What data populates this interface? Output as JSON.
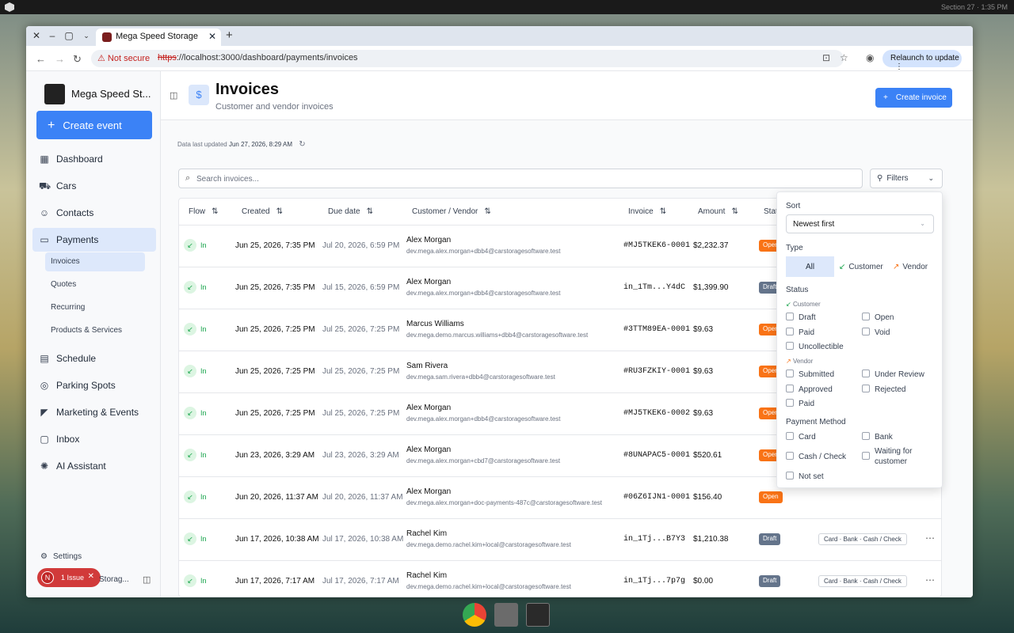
{
  "os": {
    "clock": "Section 27 · 1:35 PM"
  },
  "browser": {
    "tab_title": "Mega Speed Storage",
    "not_secure": "Not secure",
    "url_protocol": "https",
    "url_rest": "://localhost:3000/dashboard/payments/invoices",
    "relaunch": "Relaunch to update"
  },
  "sidebar": {
    "brand": "Mega Speed St...",
    "logo_text": "MEGA SPEED STORAGE",
    "create_event": "Create event",
    "items": [
      {
        "label": "Dashboard",
        "icon": "grid-icon"
      },
      {
        "label": "Cars",
        "icon": "car-icon"
      },
      {
        "label": "Contacts",
        "icon": "users-icon"
      },
      {
        "label": "Payments",
        "icon": "card-icon"
      },
      {
        "label": "Schedule",
        "icon": "calendar-icon"
      },
      {
        "label": "Parking Spots",
        "icon": "pin-icon"
      },
      {
        "label": "Marketing & Events",
        "icon": "megaphone-icon"
      },
      {
        "label": "Inbox",
        "icon": "chat-icon"
      },
      {
        "label": "AI Assistant",
        "icon": "brain-icon"
      }
    ],
    "sub_items": [
      "Invoices",
      "Quotes",
      "Recurring",
      "Products & Services"
    ],
    "settings": "Settings",
    "issue_avatar": "N",
    "issue_label": "1 Issue",
    "footer_name": "Storag..."
  },
  "header": {
    "title": "Invoices",
    "subtitle": "Customer and vendor invoices",
    "create_invoice": "Create invoice"
  },
  "updated": {
    "label": "Data last updated",
    "value": "Jun 27, 2026, 8:29 AM"
  },
  "search": {
    "placeholder": "Search invoices..."
  },
  "filters_button": "Filters",
  "table": {
    "columns": [
      "Flow",
      "Created",
      "Due date",
      "Customer / Vendor",
      "Invoice",
      "Amount",
      "Stat"
    ],
    "rows": [
      {
        "flow": "In",
        "created": "Jun 25, 2026, 7:35 PM",
        "due": "Jul 20, 2026, 6:59 PM",
        "name": "Alex Morgan",
        "email": "dev.mega.alex.morgan+dbb4@carstoragesoftware.test",
        "invoice": "#MJ5TKEK6-0001",
        "amount": "$2,232.37",
        "status": "Open",
        "pm": ""
      },
      {
        "flow": "In",
        "created": "Jun 25, 2026, 7:35 PM",
        "due": "Jul 15, 2026, 6:59 PM",
        "name": "Alex Morgan",
        "email": "dev.mega.alex.morgan+dbb4@carstoragesoftware.test",
        "invoice": "in_1Tm...Y4dC",
        "amount": "$1,399.90",
        "status": "Draft",
        "pm": ""
      },
      {
        "flow": "In",
        "created": "Jun 25, 2026, 7:25 PM",
        "due": "Jul 25, 2026, 7:25 PM",
        "name": "Marcus Williams",
        "email": "dev.mega.demo.marcus.williams+dbb4@carstoragesoftware.test",
        "invoice": "#3TTM89EA-0001",
        "amount": "$9.63",
        "status": "Open",
        "pm": ""
      },
      {
        "flow": "In",
        "created": "Jun 25, 2026, 7:25 PM",
        "due": "Jul 25, 2026, 7:25 PM",
        "name": "Sam Rivera",
        "email": "dev.mega.sam.rivera+dbb4@carstoragesoftware.test",
        "invoice": "#RU3FZKIY-0001",
        "amount": "$9.63",
        "status": "Open",
        "pm": ""
      },
      {
        "flow": "In",
        "created": "Jun 25, 2026, 7:25 PM",
        "due": "Jul 25, 2026, 7:25 PM",
        "name": "Alex Morgan",
        "email": "dev.mega.alex.morgan+dbb4@carstoragesoftware.test",
        "invoice": "#MJ5TKEK6-0002",
        "amount": "$9.63",
        "status": "Open",
        "pm": ""
      },
      {
        "flow": "In",
        "created": "Jun 23, 2026, 3:29 AM",
        "due": "Jul 23, 2026, 3:29 AM",
        "name": "Alex Morgan",
        "email": "dev.mega.alex.morgan+cbd7@carstoragesoftware.test",
        "invoice": "#8UNAPAC5-0001",
        "amount": "$520.61",
        "status": "Open",
        "pm": ""
      },
      {
        "flow": "In",
        "created": "Jun 20, 2026, 11:37 AM",
        "due": "Jul 20, 2026, 11:37 AM",
        "name": "Alex Morgan",
        "email": "dev.mega.alex.morgan+doc-payments-487c@carstoragesoftware.test",
        "invoice": "#06Z6IJN1-0001",
        "amount": "$156.40",
        "status": "Open",
        "pm": ""
      },
      {
        "flow": "In",
        "created": "Jun 17, 2026, 10:38 AM",
        "due": "Jul 17, 2026, 10:38 AM",
        "name": "Rachel Kim",
        "email": "dev.mega.demo.rachel.kim+local@carstoragesoftware.test",
        "invoice": "in_1Tj...B7Y3",
        "amount": "$1,210.38",
        "status": "Draft",
        "pm": "Card · Bank · Cash / Check"
      },
      {
        "flow": "In",
        "created": "Jun 17, 2026, 7:17 AM",
        "due": "Jul 17, 2026, 7:17 AM",
        "name": "Rachel Kim",
        "email": "dev.mega.demo.rachel.kim+local@carstoragesoftware.test",
        "invoice": "in_1Tj...7p7g",
        "amount": "$0.00",
        "status": "Draft",
        "pm": "Card · Bank · Cash / Check"
      }
    ]
  },
  "filter_panel": {
    "sort_label": "Sort",
    "sort_value": "Newest first",
    "type_label": "Type",
    "type_options": [
      "All",
      "Customer",
      "Vendor"
    ],
    "status_label": "Status",
    "customer_group": "Customer",
    "customer_statuses": [
      "Draft",
      "Open",
      "Paid",
      "Void",
      "Uncollectible"
    ],
    "vendor_group": "Vendor",
    "vendor_statuses": [
      "Submitted",
      "Under Review",
      "Approved",
      "Rejected",
      "Paid"
    ],
    "payment_label": "Payment Method",
    "payment_methods": [
      "Card",
      "Bank",
      "Cash / Check",
      "Waiting for customer",
      "Not set"
    ]
  },
  "colors": {
    "accent": "#3b82f6",
    "open": "#f97316",
    "draft": "#64748b",
    "in": "#16a34a"
  }
}
